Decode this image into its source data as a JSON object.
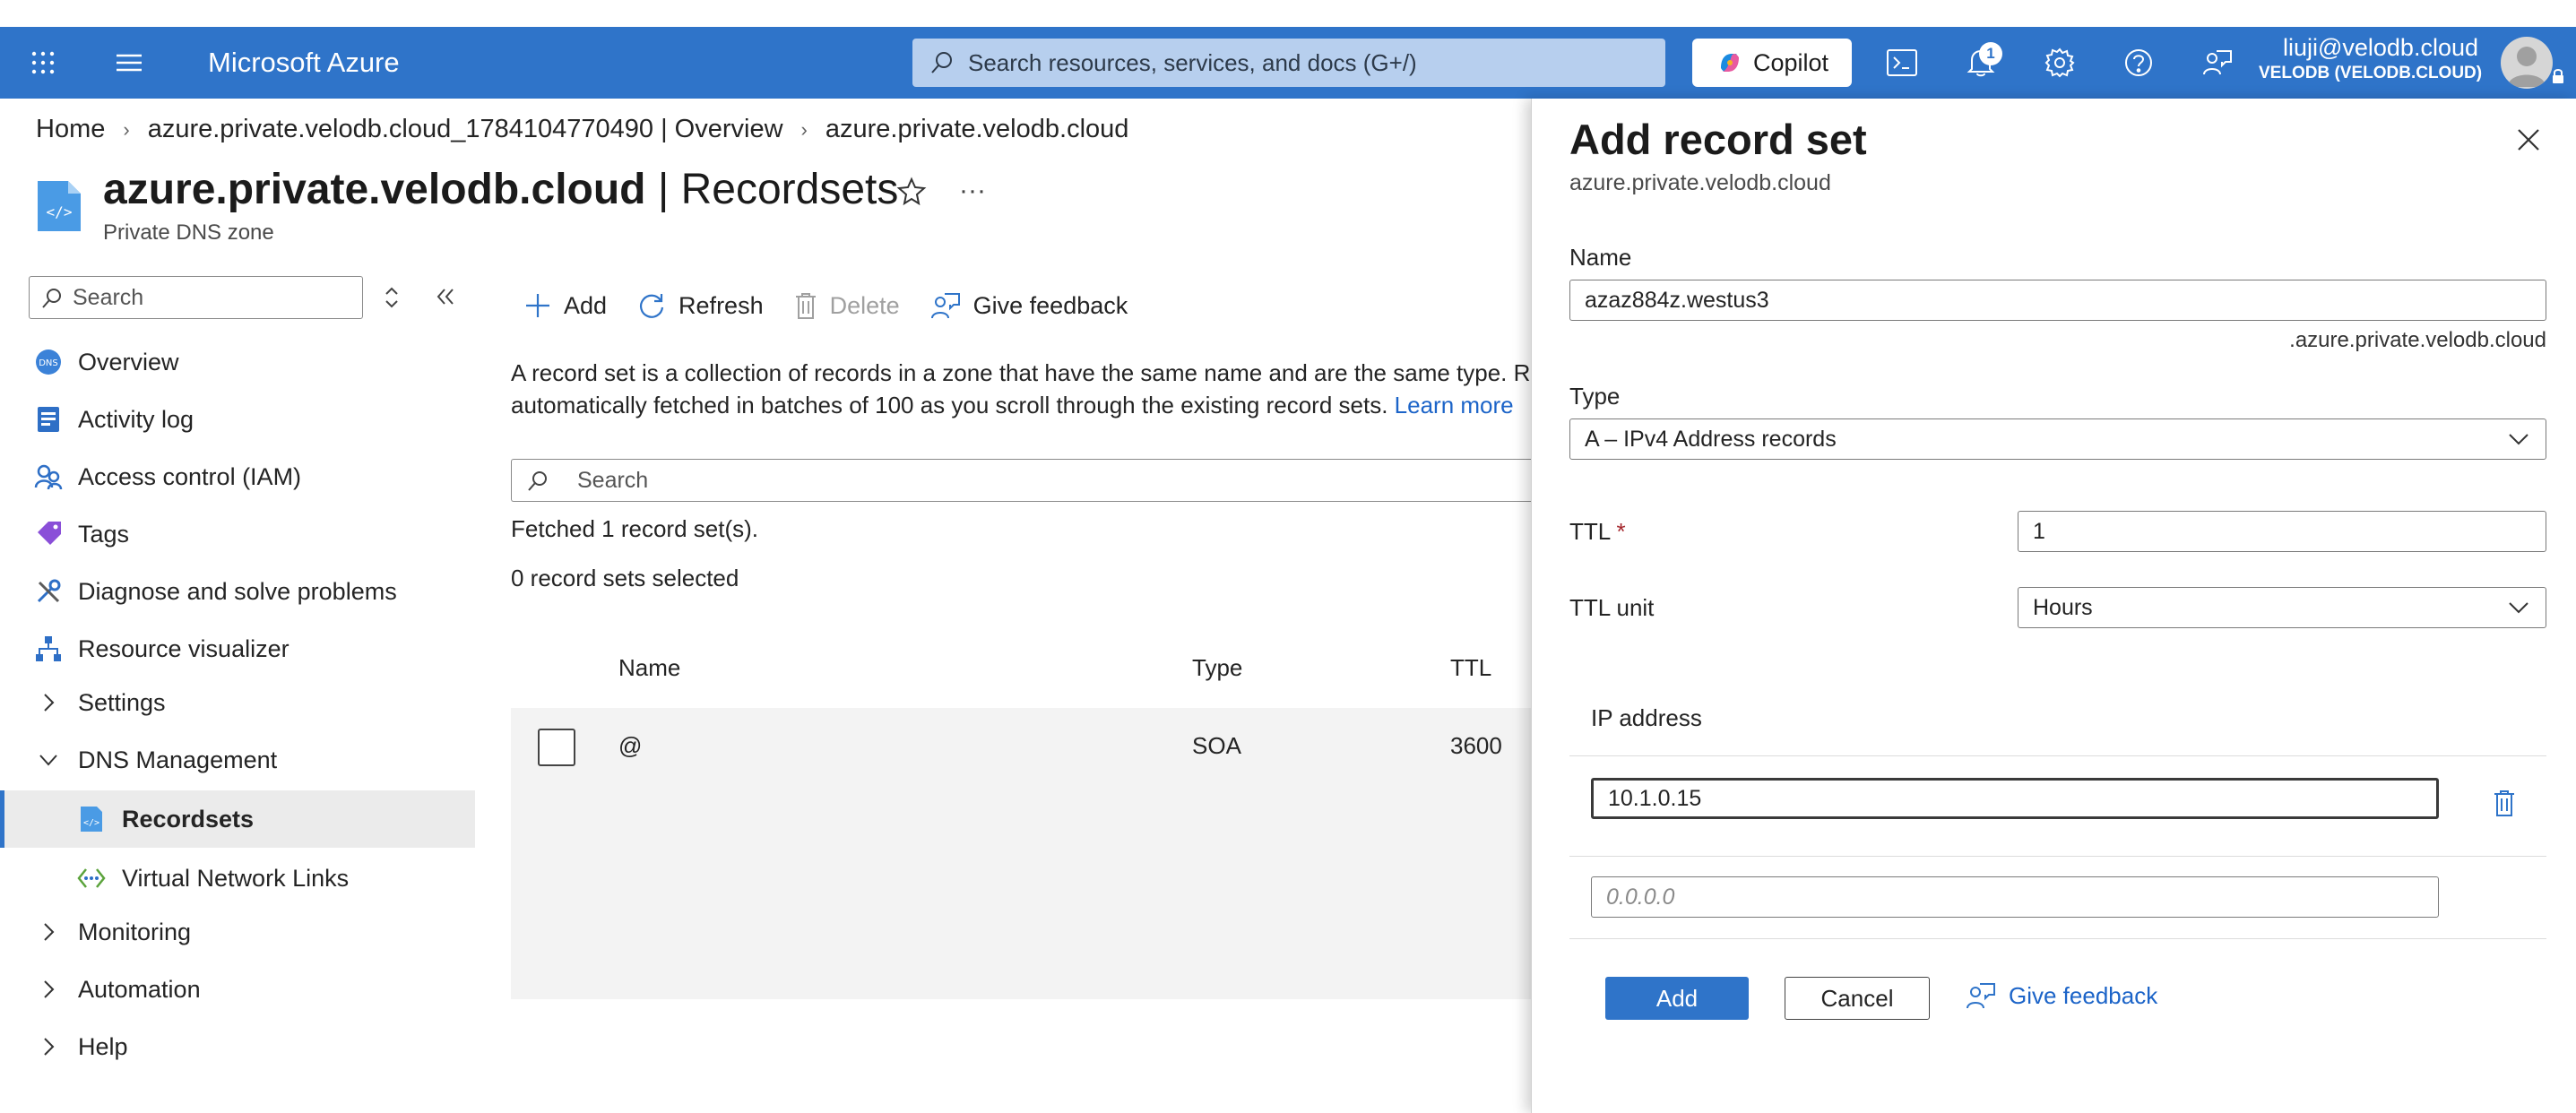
{
  "topbar": {
    "brand": "Microsoft Azure",
    "search_placeholder": "Search resources, services, and docs (G+/)",
    "copilot_label": "Copilot",
    "notification_count": "1",
    "user_email": "liuji@velodb.cloud",
    "user_tenant": "VELODB (VELODB.CLOUD)"
  },
  "breadcrumb": {
    "items": [
      "Home",
      "azure.private.velodb.cloud_1784104770490 | Overview",
      "azure.private.velodb.cloud"
    ]
  },
  "header": {
    "resource_name": "azure.private.velodb.cloud",
    "page_name": "Recordsets",
    "subtitle": "Private DNS zone"
  },
  "nav": {
    "search_placeholder": "Search",
    "items": [
      {
        "label": "Overview",
        "icon": "dns-zone-icon"
      },
      {
        "label": "Activity log",
        "icon": "activity-log-icon"
      },
      {
        "label": "Access control (IAM)",
        "icon": "iam-icon"
      },
      {
        "label": "Tags",
        "icon": "tag-icon"
      },
      {
        "label": "Diagnose and solve problems",
        "icon": "wrench-icon"
      },
      {
        "label": "Resource visualizer",
        "icon": "visualizer-icon"
      },
      {
        "label": "Settings",
        "icon": "chevron-right-icon"
      },
      {
        "label": "DNS Management",
        "icon": "chevron-down-icon"
      },
      {
        "label": "Recordsets",
        "icon": "recordset-icon",
        "active": true
      },
      {
        "label": "Virtual Network Links",
        "icon": "network-link-icon"
      },
      {
        "label": "Monitoring",
        "icon": "chevron-right-icon"
      },
      {
        "label": "Automation",
        "icon": "chevron-right-icon"
      },
      {
        "label": "Help",
        "icon": "chevron-right-icon"
      }
    ]
  },
  "toolbar": {
    "add": "Add",
    "refresh": "Refresh",
    "delete": "Delete",
    "feedback": "Give feedback"
  },
  "main": {
    "description_line1": "A record set is a collection of records in a zone that have the same name and are the same type. Rec",
    "description_line2": "automatically fetched in batches of 100 as you scroll through the existing record sets.",
    "learn_more": "Learn more",
    "search_placeholder": "Search",
    "fetched_text": "Fetched 1 record set(s).",
    "selected_text": "0 record sets selected",
    "columns": [
      "Name",
      "Type",
      "TTL"
    ],
    "rows": [
      {
        "name": "@",
        "type": "SOA",
        "ttl": "3600"
      }
    ]
  },
  "panel": {
    "title": "Add record set",
    "subtitle": "azure.private.velodb.cloud",
    "name_label": "Name",
    "name_value": "azaz884z.westus3",
    "name_suffix": ".azure.private.velodb.cloud",
    "type_label": "Type",
    "type_value": "A – IPv4 Address records",
    "ttl_label": "TTL",
    "ttl_required": "*",
    "ttl_value": "1",
    "ttl_unit_label": "TTL unit",
    "ttl_unit_value": "Hours",
    "ip_header": "IP address",
    "ip_values": [
      "10.1.0.15"
    ],
    "ip_placeholder": "0.0.0.0",
    "add_button": "Add",
    "cancel_button": "Cancel",
    "feedback": "Give feedback"
  },
  "colors": {
    "accent": "#2f74c9",
    "link": "#1c64c8",
    "row_bg": "#f3f3f3"
  }
}
